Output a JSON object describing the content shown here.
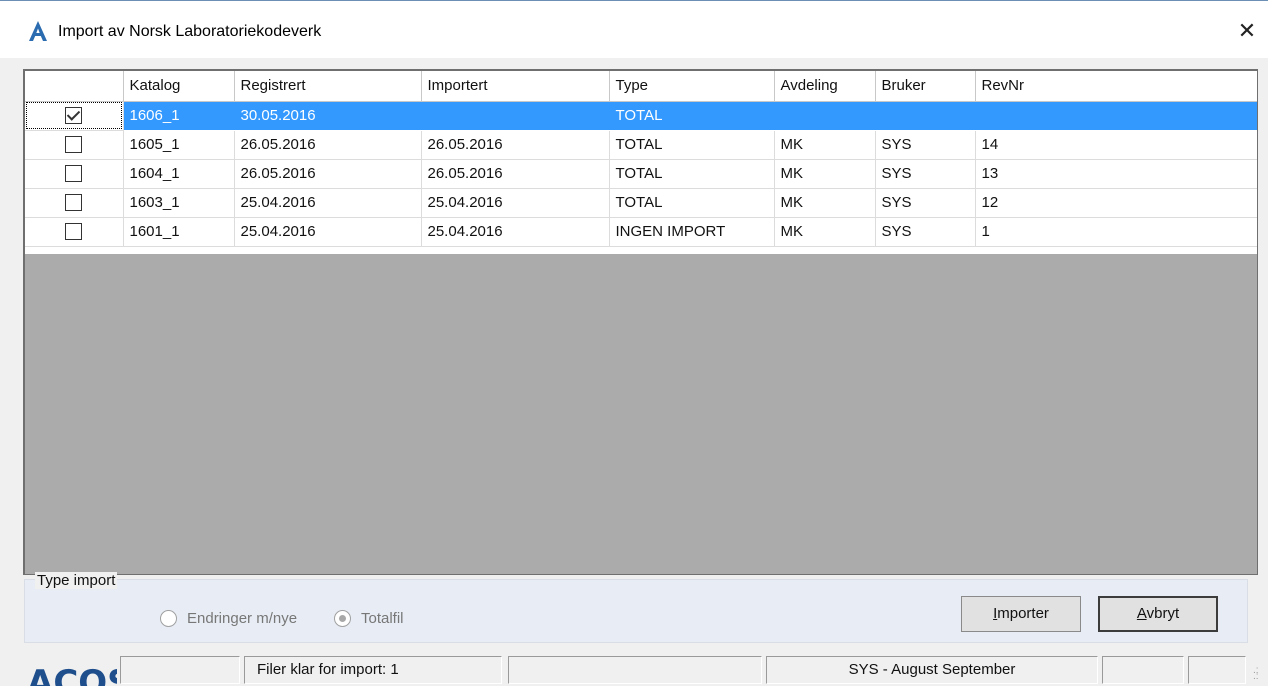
{
  "window": {
    "title": "Import av Norsk Laboratoriekodeverk",
    "close_symbol": "✕",
    "icon": "acos-a-icon"
  },
  "colors": {
    "selection": "#3399ff",
    "app_icon": "#2b6cb0",
    "logo": "#1f4e8c"
  },
  "table": {
    "columns": [
      "",
      "Katalog",
      "Registrert",
      "Importert",
      "Type",
      "Avdeling",
      "Bruker",
      "RevNr"
    ],
    "rows": [
      {
        "checked": true,
        "selected": true,
        "katalog": "1606_1",
        "registrert": "30.05.2016",
        "importert": "",
        "type": "TOTAL",
        "avdeling": "",
        "bruker": "",
        "revnr": ""
      },
      {
        "checked": false,
        "selected": false,
        "katalog": "1605_1",
        "registrert": "26.05.2016",
        "importert": "26.05.2016",
        "type": "TOTAL",
        "avdeling": "MK",
        "bruker": "SYS",
        "revnr": "14"
      },
      {
        "checked": false,
        "selected": false,
        "katalog": "1604_1",
        "registrert": "26.05.2016",
        "importert": "26.05.2016",
        "type": "TOTAL",
        "avdeling": "MK",
        "bruker": "SYS",
        "revnr": "13"
      },
      {
        "checked": false,
        "selected": false,
        "katalog": "1603_1",
        "registrert": "25.04.2016",
        "importert": "25.04.2016",
        "type": "TOTAL",
        "avdeling": "MK",
        "bruker": "SYS",
        "revnr": "12"
      },
      {
        "checked": false,
        "selected": false,
        "katalog": "1601_1",
        "registrert": "25.04.2016",
        "importert": "25.04.2016",
        "type": "INGEN IMPORT",
        "avdeling": "MK",
        "bruker": "SYS",
        "revnr": "1"
      }
    ]
  },
  "type_import": {
    "label": "Type import",
    "options": [
      {
        "label": "Endringer m/nye",
        "selected": false,
        "enabled": false
      },
      {
        "label": "Totalfil",
        "selected": true,
        "enabled": false
      }
    ]
  },
  "buttons": {
    "import": {
      "mnemonic": "I",
      "rest": "mporter"
    },
    "cancel": {
      "mnemonic": "A",
      "rest": "vbryt"
    }
  },
  "statusbar": {
    "logo_text": "ACOS",
    "pane1": "",
    "pane2": "Filer klar for import: 1",
    "pane3": "",
    "pane4": "SYS - August September",
    "pane5": "",
    "pane6": ""
  }
}
